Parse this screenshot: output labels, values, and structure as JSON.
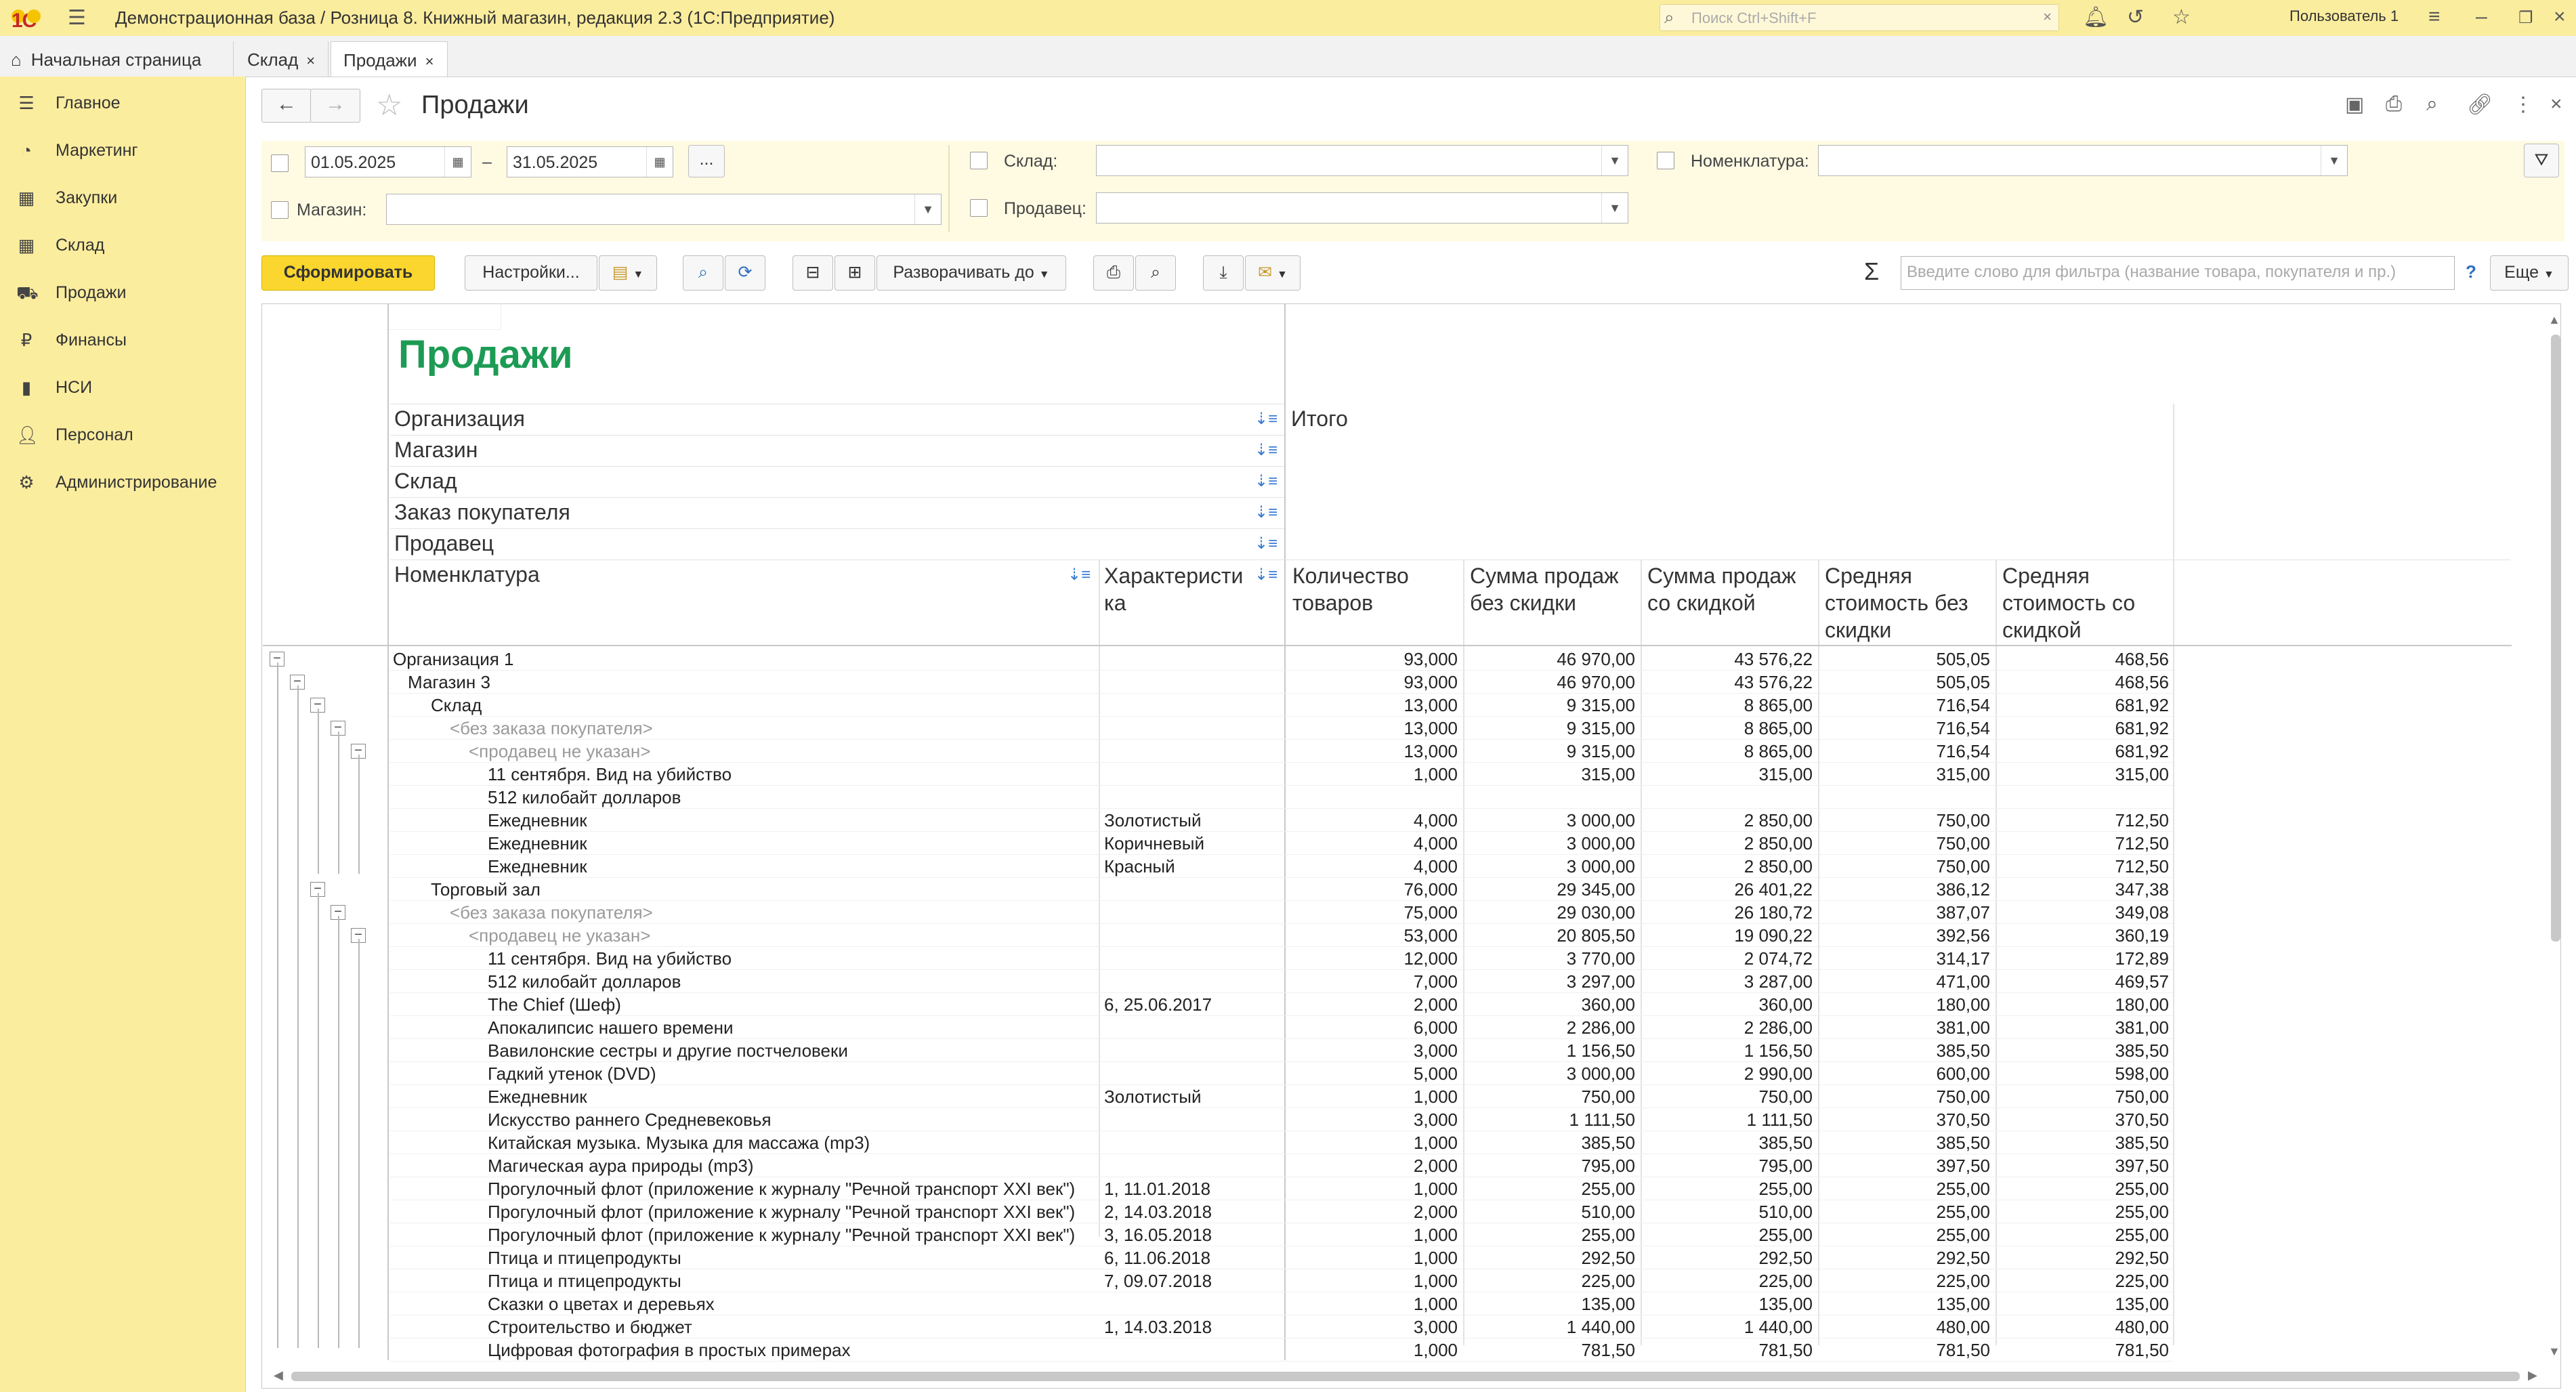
{
  "window": {
    "title": "Демонстрационная база / Розница 8. Книжный магазин, редакция 2.3  (1С:Предприятие)",
    "logo": "1С"
  },
  "search": {
    "placeholder": "Поиск Ctrl+Shift+F"
  },
  "user": {
    "name": "Пользователь 1"
  },
  "tabs": [
    {
      "label": "Начальная страница"
    },
    {
      "label": "Склад"
    },
    {
      "label": "Продажи"
    }
  ],
  "sidebar": {
    "items": [
      {
        "label": "Главное",
        "icon": "menu-icon"
      },
      {
        "label": "Маркетинг",
        "icon": "pie-chart-icon"
      },
      {
        "label": "Закупки",
        "icon": "cart-grid-icon"
      },
      {
        "label": "Склад",
        "icon": "warehouse-grid-icon"
      },
      {
        "label": "Продажи",
        "icon": "basket-icon"
      },
      {
        "label": "Финансы",
        "icon": "ruble-icon"
      },
      {
        "label": "НСИ",
        "icon": "book-icon"
      },
      {
        "label": "Персонал",
        "icon": "person-icon"
      },
      {
        "label": "Администрирование",
        "icon": "gear-icon"
      }
    ]
  },
  "form": {
    "title": "Продажи"
  },
  "filters": {
    "date_from": "01.05.2025",
    "date_to": "31.05.2025",
    "date_separator": "–",
    "dots": "...",
    "sklad_label": "Склад:",
    "nomenklatura_label": "Номенклатура:",
    "magazin_label": "Магазин:",
    "prodavec_label": "Продавец:"
  },
  "toolbar": {
    "generate": "Сформировать",
    "settings": "Настройки...",
    "expand": "Разворачивать до",
    "filter_placeholder": "Введите слово для фильтра (название товара, покупателя и пр.)",
    "help": "?",
    "more": "Еще",
    "sigma": "Σ"
  },
  "report": {
    "title": "Продажи",
    "groupings": [
      "Организация",
      "Магазин",
      "Склад",
      "Заказ покупателя",
      "Продавец"
    ],
    "nom_header": "Номенклатура",
    "char_header_1": "Характеристи",
    "char_header_2": "ка",
    "itogo": "Итого",
    "columns": [
      [
        "Количество",
        "товаров"
      ],
      [
        "Сумма продаж",
        "без скидки"
      ],
      [
        "Сумма продаж",
        "со скидкой"
      ],
      [
        "Средняя",
        "стоимость без",
        "скидки"
      ],
      [
        "Средняя",
        "стоимость со",
        "скидкой"
      ]
    ],
    "rows": [
      {
        "lvl": 0,
        "name": "Организация 1",
        "char": "",
        "v": [
          "93,000",
          "46 970,00",
          "43 576,22",
          "505,05",
          "468,56"
        ]
      },
      {
        "lvl": 1,
        "name": "Магазин 3",
        "char": "",
        "v": [
          "93,000",
          "46 970,00",
          "43 576,22",
          "505,05",
          "468,56"
        ]
      },
      {
        "lvl": 2,
        "name": "Склад",
        "char": "",
        "v": [
          "13,000",
          "9 315,00",
          "8 865,00",
          "716,54",
          "681,92"
        ]
      },
      {
        "lvl": 3,
        "name": "<без заказа покупателя>",
        "char": "",
        "gray": true,
        "v": [
          "13,000",
          "9 315,00",
          "8 865,00",
          "716,54",
          "681,92"
        ]
      },
      {
        "lvl": 4,
        "name": "<продавец не указан>",
        "char": "",
        "gray": true,
        "v": [
          "13,000",
          "9 315,00",
          "8 865,00",
          "716,54",
          "681,92"
        ]
      },
      {
        "lvl": 5,
        "name": "11 сентября. Вид на убийство",
        "char": "",
        "v": [
          "1,000",
          "315,00",
          "315,00",
          "315,00",
          "315,00"
        ]
      },
      {
        "lvl": 5,
        "name": "512 килобайт долларов",
        "char": "",
        "v": [
          "",
          "",
          "",
          "",
          ""
        ]
      },
      {
        "lvl": 5,
        "name": "Ежедневник",
        "char": "Золотистый",
        "v": [
          "4,000",
          "3 000,00",
          "2 850,00",
          "750,00",
          "712,50"
        ]
      },
      {
        "lvl": 5,
        "name": "Ежедневник",
        "char": "Коричневый",
        "v": [
          "4,000",
          "3 000,00",
          "2 850,00",
          "750,00",
          "712,50"
        ]
      },
      {
        "lvl": 5,
        "name": "Ежедневник",
        "char": "Красный",
        "v": [
          "4,000",
          "3 000,00",
          "2 850,00",
          "750,00",
          "712,50"
        ]
      },
      {
        "lvl": 2,
        "name": "Торговый зал",
        "char": "",
        "v": [
          "76,000",
          "29 345,00",
          "26 401,22",
          "386,12",
          "347,38"
        ]
      },
      {
        "lvl": 3,
        "name": "<без заказа покупателя>",
        "char": "",
        "gray": true,
        "v": [
          "75,000",
          "29 030,00",
          "26 180,72",
          "387,07",
          "349,08"
        ]
      },
      {
        "lvl": 4,
        "name": "<продавец не указан>",
        "char": "",
        "gray": true,
        "v": [
          "53,000",
          "20 805,50",
          "19 090,22",
          "392,56",
          "360,19"
        ]
      },
      {
        "lvl": 5,
        "name": "11 сентября. Вид на убийство",
        "char": "",
        "v": [
          "12,000",
          "3 770,00",
          "2 074,72",
          "314,17",
          "172,89"
        ]
      },
      {
        "lvl": 5,
        "name": "512 килобайт долларов",
        "char": "",
        "v": [
          "7,000",
          "3 297,00",
          "3 287,00",
          "471,00",
          "469,57"
        ]
      },
      {
        "lvl": 5,
        "name": "The Chief (Шеф)",
        "char": "6, 25.06.2017",
        "v": [
          "2,000",
          "360,00",
          "360,00",
          "180,00",
          "180,00"
        ]
      },
      {
        "lvl": 5,
        "name": "Апокалипсис нашего времени",
        "char": "",
        "v": [
          "6,000",
          "2 286,00",
          "2 286,00",
          "381,00",
          "381,00"
        ]
      },
      {
        "lvl": 5,
        "name": "Вавилонские сестры и другие постчеловеки",
        "char": "",
        "v": [
          "3,000",
          "1 156,50",
          "1 156,50",
          "385,50",
          "385,50"
        ]
      },
      {
        "lvl": 5,
        "name": "Гадкий утенок (DVD)",
        "char": "",
        "v": [
          "5,000",
          "3 000,00",
          "2 990,00",
          "600,00",
          "598,00"
        ]
      },
      {
        "lvl": 5,
        "name": "Ежедневник",
        "char": "Золотистый",
        "v": [
          "1,000",
          "750,00",
          "750,00",
          "750,00",
          "750,00"
        ]
      },
      {
        "lvl": 5,
        "name": "Искусство раннего Средневековья",
        "char": "",
        "v": [
          "3,000",
          "1 111,50",
          "1 111,50",
          "370,50",
          "370,50"
        ]
      },
      {
        "lvl": 5,
        "name": "Китайская музыка. Музыка для массажа (mp3)",
        "char": "",
        "v": [
          "1,000",
          "385,50",
          "385,50",
          "385,50",
          "385,50"
        ]
      },
      {
        "lvl": 5,
        "name": "Магическая аура природы (mp3)",
        "char": "",
        "v": [
          "2,000",
          "795,00",
          "795,00",
          "397,50",
          "397,50"
        ]
      },
      {
        "lvl": 5,
        "name": "Прогулочный флот (приложение к журналу \"Речной транспорт XXI век\")",
        "char": "1, 11.01.2018",
        "v": [
          "1,000",
          "255,00",
          "255,00",
          "255,00",
          "255,00"
        ]
      },
      {
        "lvl": 5,
        "name": "Прогулочный флот (приложение к журналу \"Речной транспорт XXI век\")",
        "char": "2, 14.03.2018",
        "v": [
          "2,000",
          "510,00",
          "510,00",
          "255,00",
          "255,00"
        ]
      },
      {
        "lvl": 5,
        "name": "Прогулочный флот (приложение к журналу \"Речной транспорт XXI век\")",
        "char": "3, 16.05.2018",
        "v": [
          "1,000",
          "255,00",
          "255,00",
          "255,00",
          "255,00"
        ]
      },
      {
        "lvl": 5,
        "name": "Птица и птицепродукты",
        "char": "6, 11.06.2018",
        "v": [
          "1,000",
          "292,50",
          "292,50",
          "292,50",
          "292,50"
        ]
      },
      {
        "lvl": 5,
        "name": "Птица и птицепродукты",
        "char": "7, 09.07.2018",
        "v": [
          "1,000",
          "225,00",
          "225,00",
          "225,00",
          "225,00"
        ]
      },
      {
        "lvl": 5,
        "name": "Сказки о цветах и деревьях",
        "char": "",
        "v": [
          "1,000",
          "135,00",
          "135,00",
          "135,00",
          "135,00"
        ]
      },
      {
        "lvl": 5,
        "name": "Строительство и бюджет",
        "char": "1, 14.03.2018",
        "v": [
          "3,000",
          "1 440,00",
          "1 440,00",
          "480,00",
          "480,00"
        ]
      },
      {
        "lvl": 5,
        "name": "Цифровая фотография в простых примерах",
        "char": "",
        "v": [
          "1,000",
          "781,50",
          "781,50",
          "781,50",
          "781,50"
        ]
      }
    ]
  }
}
